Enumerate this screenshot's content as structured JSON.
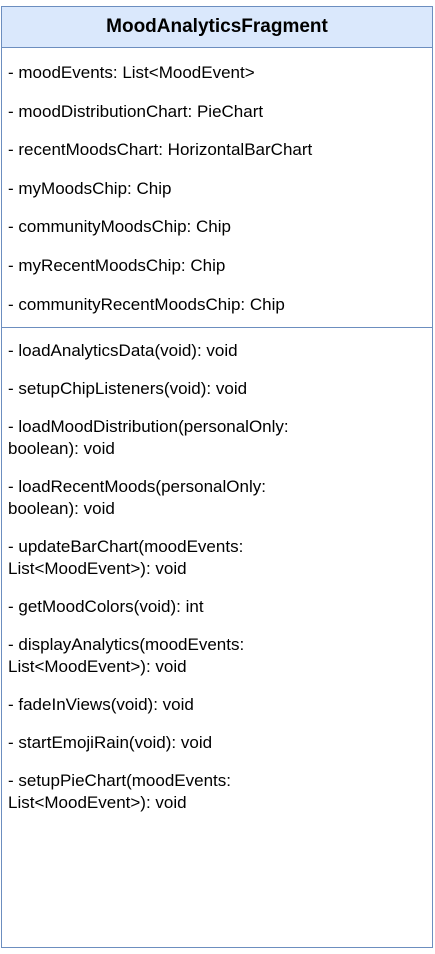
{
  "class": {
    "name": "MoodAnalyticsFragment",
    "attributes": [
      "- moodEvents: List<MoodEvent>",
      "- moodDistributionChart: PieChart",
      "- recentMoodsChart: HorizontalBarChart",
      "- myMoodsChip: Chip",
      "- communityMoodsChip: Chip",
      "- myRecentMoodsChip: Chip",
      "- communityRecentMoodsChip: Chip"
    ],
    "methods": [
      "- loadAnalyticsData(void): void",
      "- setupChipListeners(void): void",
      "- loadMoodDistribution(personalOnly: boolean): void",
      "- loadRecentMoods(personalOnly: boolean): void",
      "- updateBarChart(moodEvents: List<MoodEvent>): void",
      "- getMoodColors(void): int",
      "- displayAnalytics(moodEvents: List<MoodEvent>): void",
      "- fadeInViews(void): void",
      "- startEmojiRain(void): void",
      "- setupPieChart(moodEvents: List<MoodEvent>): void"
    ]
  },
  "colors": {
    "header_fill": "#dae8fc",
    "border": "#6c8ebf"
  }
}
